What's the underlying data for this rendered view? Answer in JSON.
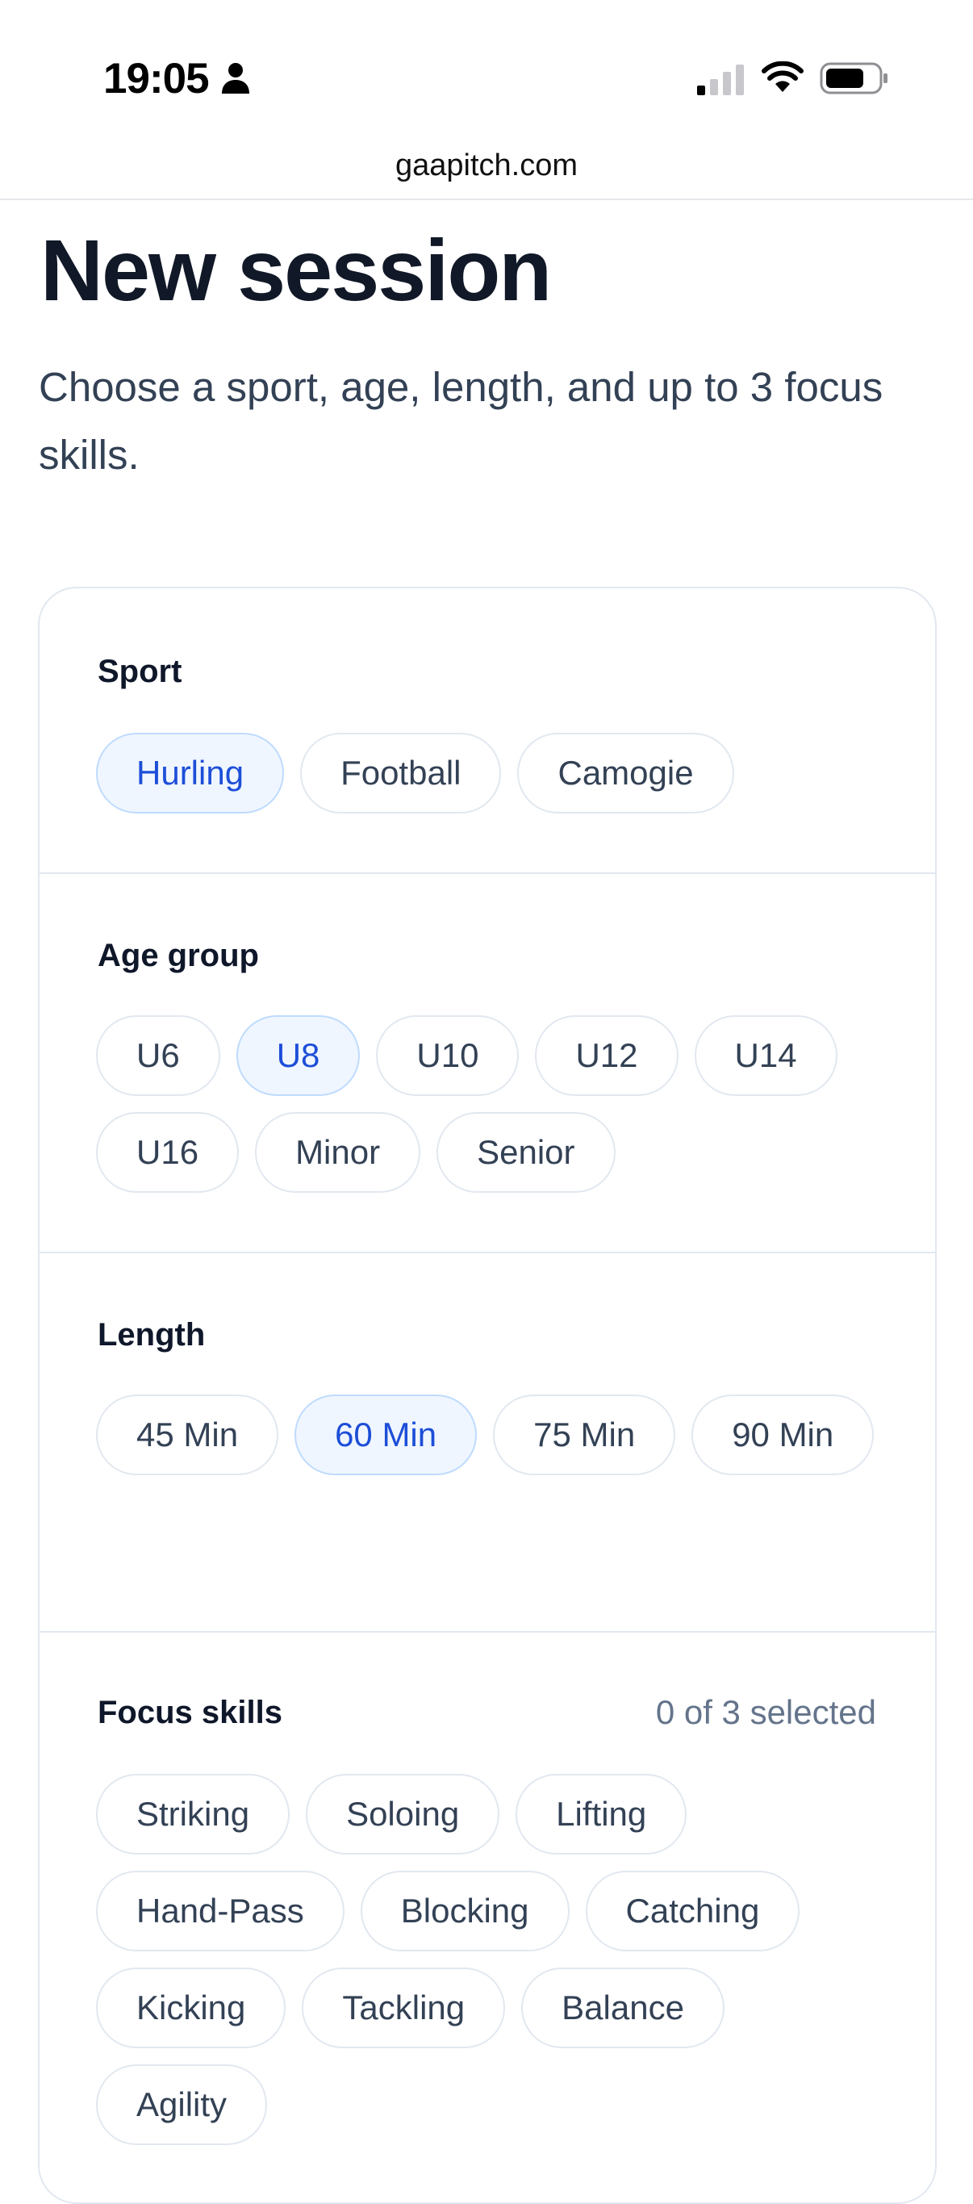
{
  "status_bar": {
    "time": "19:05",
    "icons": [
      "person-icon",
      "cellular-signal-icon",
      "wifi-icon",
      "battery-icon"
    ]
  },
  "browser": {
    "url": "gaapitch.com"
  },
  "page": {
    "title": "New session",
    "subtitle": "Choose a sport, age, length, and up to 3 focus skills."
  },
  "sport": {
    "label": "Sport",
    "options": [
      "Hurling",
      "Football",
      "Camogie"
    ],
    "selected": "Hurling"
  },
  "age_group": {
    "label": "Age group",
    "options": [
      "U6",
      "U8",
      "U10",
      "U12",
      "U14",
      "U16",
      "Minor",
      "Senior"
    ],
    "selected": "U8"
  },
  "length": {
    "label": "Length",
    "options": [
      "45 Min",
      "60 Min",
      "75 Min",
      "90 Min"
    ],
    "selected": "60 Min"
  },
  "focus_skills": {
    "label": "Focus skills",
    "count_text": "0 of 3 selected",
    "options": [
      "Striking",
      "Soloing",
      "Lifting",
      "Hand-Pass",
      "Blocking",
      "Catching",
      "Kicking",
      "Tackling",
      "Balance",
      "Agility"
    ]
  },
  "colors": {
    "selected_chip_bg": "#eff6ff",
    "selected_chip_border": "#bfdbfe",
    "selected_chip_text": "#1d4ed8",
    "chip_border": "#e2e8f0",
    "title_text": "#111827"
  }
}
